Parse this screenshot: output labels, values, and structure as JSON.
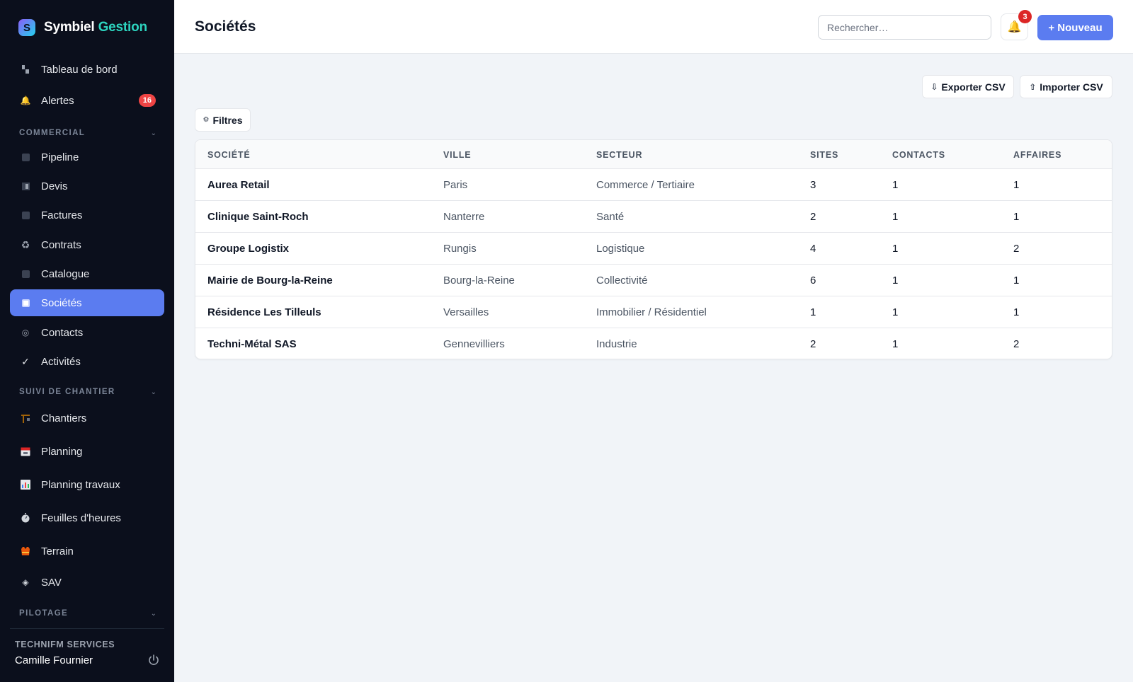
{
  "brand": {
    "name": "Symbiel",
    "accent": "Gestion",
    "logo_letter": "S"
  },
  "sidebar": {
    "top_items": [
      {
        "label": "Tableau de bord",
        "icon": "dashboard-icon"
      },
      {
        "label": "Alertes",
        "icon": "bell-icon",
        "badge": "16"
      }
    ],
    "sections": [
      {
        "title": "COMMERCIAL",
        "items": [
          {
            "label": "Pipeline",
            "icon": "square-icon"
          },
          {
            "label": "Devis",
            "icon": "half-square-icon"
          },
          {
            "label": "Factures",
            "icon": "square-icon"
          },
          {
            "label": "Contrats",
            "icon": "recycle-icon"
          },
          {
            "label": "Catalogue",
            "icon": "square-icon"
          },
          {
            "label": "Sociétés",
            "icon": "square-icon",
            "active": true
          },
          {
            "label": "Contacts",
            "icon": "circle-icon"
          },
          {
            "label": "Activités",
            "icon": "check-icon"
          }
        ]
      },
      {
        "title": "SUIVI DE CHANTIER",
        "items": [
          {
            "label": "Chantiers",
            "icon": "crane-icon"
          },
          {
            "label": "Planning",
            "icon": "calendar-icon"
          },
          {
            "label": "Planning travaux",
            "icon": "bar-chart-icon"
          },
          {
            "label": "Feuilles d'heures",
            "icon": "stopwatch-icon"
          },
          {
            "label": "Terrain",
            "icon": "vest-icon"
          },
          {
            "label": "SAV",
            "icon": "diamond-icon"
          }
        ]
      },
      {
        "title": "PILOTAGE",
        "items": []
      }
    ],
    "footer": {
      "org": "TECHNIFM SERVICES",
      "user": "Camille Fournier"
    }
  },
  "header": {
    "title": "Sociétés",
    "search_placeholder": "Rechercher…",
    "notifications_count": "3",
    "new_label": "+ Nouveau"
  },
  "actions": {
    "export": "Exporter CSV",
    "import": "Importer CSV",
    "filters": "Filtres"
  },
  "table": {
    "columns": [
      "SOCIÉTÉ",
      "VILLE",
      "SECTEUR",
      "SITES",
      "CONTACTS",
      "AFFAIRES"
    ],
    "rows": [
      {
        "name": "Aurea Retail",
        "city": "Paris",
        "sector": "Commerce / Tertiaire",
        "sites": "3",
        "contacts": "1",
        "deals": "1"
      },
      {
        "name": "Clinique Saint-Roch",
        "city": "Nanterre",
        "sector": "Santé",
        "sites": "2",
        "contacts": "1",
        "deals": "1"
      },
      {
        "name": "Groupe Logistix",
        "city": "Rungis",
        "sector": "Logistique",
        "sites": "4",
        "contacts": "1",
        "deals": "2"
      },
      {
        "name": "Mairie de Bourg-la-Reine",
        "city": "Bourg-la-Reine",
        "sector": "Collectivité",
        "sites": "6",
        "contacts": "1",
        "deals": "1"
      },
      {
        "name": "Résidence Les Tilleuls",
        "city": "Versailles",
        "sector": "Immobilier / Résidentiel",
        "sites": "1",
        "contacts": "1",
        "deals": "1"
      },
      {
        "name": "Techni-Métal SAS",
        "city": "Gennevilliers",
        "sector": "Industrie",
        "sites": "2",
        "contacts": "1",
        "deals": "2"
      }
    ]
  },
  "colors": {
    "sidebar_bg": "#0b0f1c",
    "accent": "#5b7cf0",
    "brand_accent": "#2dd4bf",
    "badge": "#ef4444"
  }
}
